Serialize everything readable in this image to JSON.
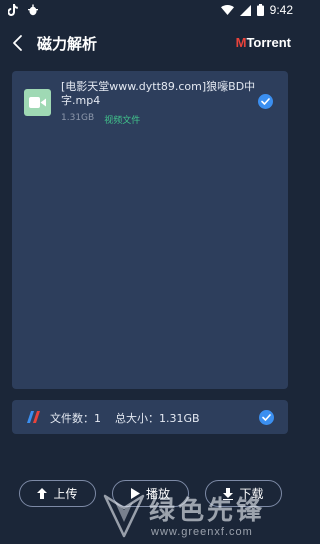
{
  "status_bar": {
    "time": "9:42",
    "left_icons": [
      "tiktok-icon",
      "bug-notification-icon"
    ],
    "right_icons": [
      "wifi-icon",
      "signal-icon",
      "battery-icon"
    ]
  },
  "header": {
    "back_icon": "chevron-left-icon",
    "title": "磁力解析",
    "brand_prefix": "M",
    "brand_suffix": "Torrent"
  },
  "files": [
    {
      "name": "[电影天堂www.dytt89.com]狼嚎BD中字.mp4",
      "size": "1.31GB",
      "type": "视频文件",
      "icon": "video-camera-icon",
      "checked": true
    }
  ],
  "summary": {
    "text": "文件数：1    总大小：1.31GB",
    "checked": true
  },
  "actions": {
    "upload_label": "上传",
    "play_label": "播放",
    "download_label": "下载"
  },
  "watermark": {
    "title": "绿色先锋",
    "url": "www.greenxf.com"
  },
  "colors": {
    "background": "#1b2638",
    "panel": "#2d3e5c",
    "accent_blue": "#3b8ff0",
    "file_type_green": "#41c58c",
    "brand_red": "#e8433b"
  }
}
